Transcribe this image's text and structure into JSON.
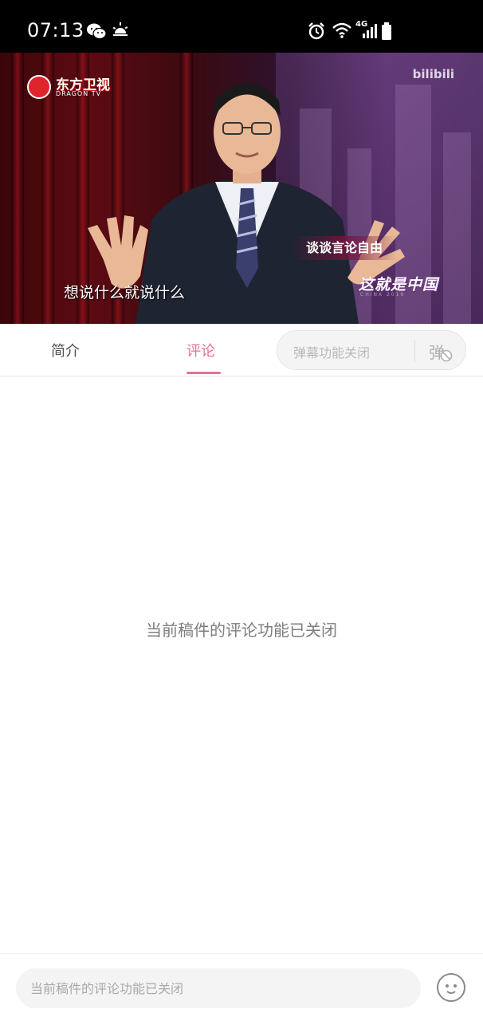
{
  "status_bar": {
    "time": "07:13",
    "network_label": "4G",
    "icons": [
      "wechat-icon",
      "sunrise-icon",
      "alarm-icon",
      "wifi-icon",
      "signal-icon",
      "battery-icon"
    ]
  },
  "video": {
    "channel_logo_cn": "东方卫视",
    "channel_logo_en": "DRAGON TV",
    "watermark": "bilibili",
    "subtitle": "想说什么就说什么",
    "topic_caption": "谈谈言论自由",
    "show_title": "这就是中国",
    "show_title_sub": "CHINA 2019"
  },
  "tabs": {
    "intro_label": "简介",
    "comments_label": "评论",
    "active": "comments"
  },
  "danmaku": {
    "placeholder": "弹幕功能关闭",
    "icon_label": "弹"
  },
  "content": {
    "empty_message": "当前稿件的评论功能已关闭"
  },
  "bottom_bar": {
    "input_placeholder": "当前稿件的评论功能已关闭",
    "emoji_icon": "emoji-icon"
  },
  "colors": {
    "accent": "#e8709a",
    "tab_text": "#505050",
    "muted_text": "#7e7e7e",
    "status_bar_bg": "#000000"
  }
}
